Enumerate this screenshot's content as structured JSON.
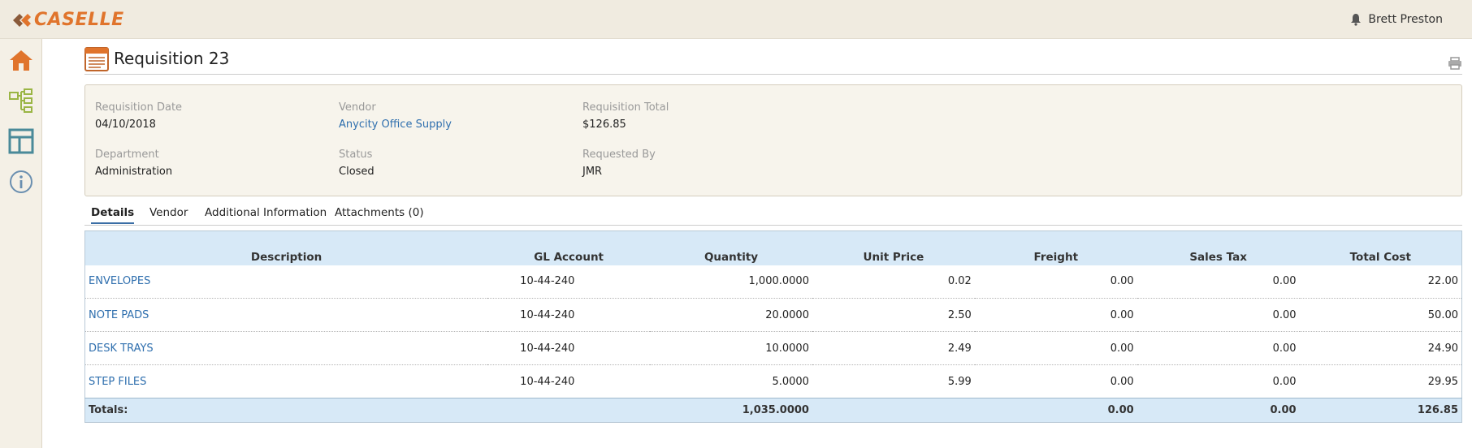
{
  "app": {
    "logo_text": "CASELLE",
    "user_name": "Brett Preston"
  },
  "sidebar": {
    "items": [
      "home-icon",
      "org-chart-icon",
      "layout-icon",
      "info-icon"
    ]
  },
  "page": {
    "title": "Requisition 23"
  },
  "info": {
    "requisition_date": {
      "label": "Requisition Date",
      "value": "04/10/2018"
    },
    "vendor": {
      "label": "Vendor",
      "value": "Anycity Office Supply"
    },
    "requisition_total": {
      "label": "Requisition Total",
      "value": "$126.85"
    },
    "department": {
      "label": "Department",
      "value": "Administration"
    },
    "status": {
      "label": "Status",
      "value": "Closed"
    },
    "requested_by": {
      "label": "Requested By",
      "value": "JMR"
    }
  },
  "tabs": [
    {
      "label": "Details",
      "active": true
    },
    {
      "label": "Vendor"
    },
    {
      "label": "Additional Information"
    },
    {
      "label": "Attachments (0)"
    }
  ],
  "table": {
    "headers": {
      "description": "Description",
      "gl_account": "GL Account",
      "quantity": "Quantity",
      "unit_price": "Unit Price",
      "freight": "Freight",
      "sales_tax": "Sales Tax",
      "total_cost": "Total Cost"
    },
    "rows": [
      {
        "description": "ENVELOPES",
        "gl_account": "10-44-240",
        "quantity": "1,000.0000",
        "unit_price": "0.02",
        "freight": "0.00",
        "sales_tax": "0.00",
        "total_cost": "22.00"
      },
      {
        "description": "NOTE PADS",
        "gl_account": "10-44-240",
        "quantity": "20.0000",
        "unit_price": "2.50",
        "freight": "0.00",
        "sales_tax": "0.00",
        "total_cost": "50.00"
      },
      {
        "description": "DESK TRAYS",
        "gl_account": "10-44-240",
        "quantity": "10.0000",
        "unit_price": "2.49",
        "freight": "0.00",
        "sales_tax": "0.00",
        "total_cost": "24.90"
      },
      {
        "description": "STEP FILES",
        "gl_account": "10-44-240",
        "quantity": "5.0000",
        "unit_price": "5.99",
        "freight": "0.00",
        "sales_tax": "0.00",
        "total_cost": "29.95"
      }
    ],
    "totals": {
      "label": "Totals:",
      "quantity": "1,035.0000",
      "freight": "0.00",
      "sales_tax": "0.00",
      "total_cost": "126.85"
    }
  },
  "colors": {
    "accent_orange": "#e0742c",
    "link_blue": "#2f6fae",
    "header_blue": "#d7e9f7",
    "icon_green": "#9ab544",
    "icon_teal": "#4a8a99"
  }
}
